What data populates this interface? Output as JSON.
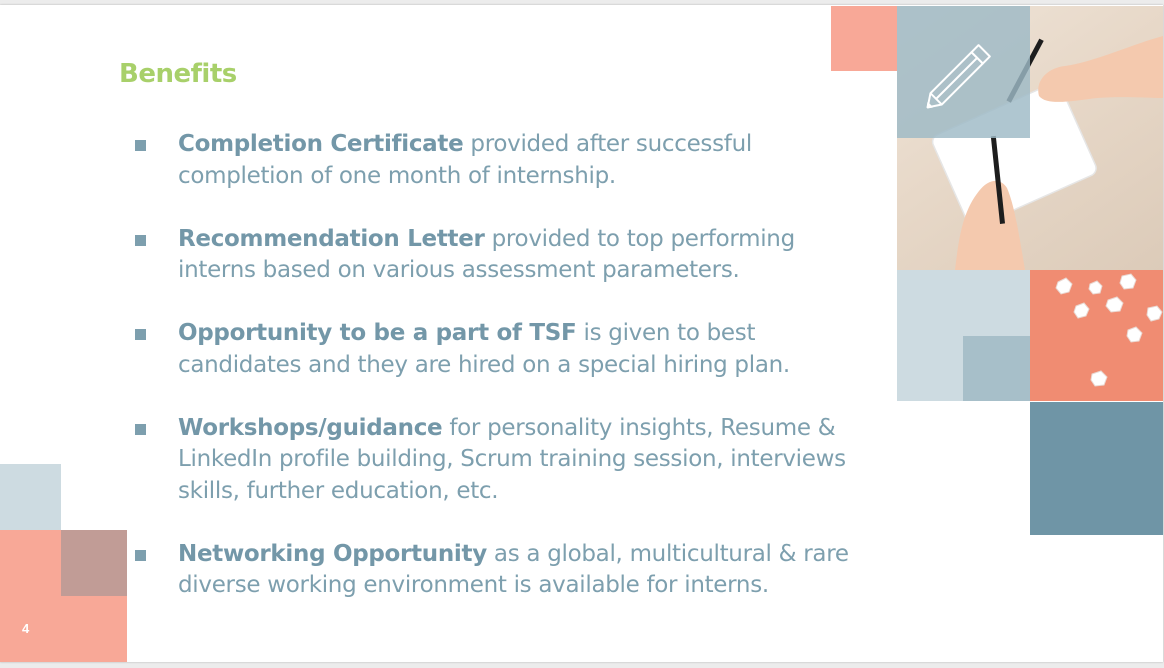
{
  "slide": {
    "title": "Benefits",
    "page_number": "4",
    "bullets": [
      {
        "bold": "Completion Certificate",
        "text": " provided after successful completion of one month of internship."
      },
      {
        "bold": "Recommendation Letter",
        "text": " provided to top performing interns based on various assessment parameters."
      },
      {
        "bold": "Opportunity to be a part of TSF",
        "text": " is given to best candidates and they are hired on a special hiring plan."
      },
      {
        "bold": "Workshops/guidance",
        "text": " for personality insights, Resume & LinkedIn profile building, Scrum training session, interviews skills, further education, etc."
      },
      {
        "bold": "Networking Opportunity",
        "text": " as a global, multicultural & rare diverse working environment is available for interns."
      }
    ]
  },
  "colors": {
    "title_green": "#a8d06a",
    "body_text": "#7d9fae",
    "salmon": "#f8a897",
    "light_blue_gray": "#cddbe1",
    "mid_blue_gray": "#a7bfc9",
    "steel_blue": "#6f95a6",
    "mauve": "#c19c96"
  },
  "icons": {
    "pencil": "pencil-icon",
    "bullet": "square-bullet-icon"
  }
}
